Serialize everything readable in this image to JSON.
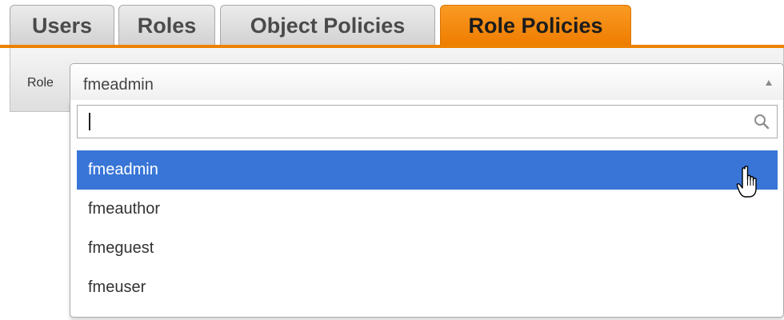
{
  "tabs": [
    {
      "label": "Users",
      "active": false
    },
    {
      "label": "Roles",
      "active": false
    },
    {
      "label": "Object Policies",
      "active": false
    },
    {
      "label": "Role Policies",
      "active": true
    }
  ],
  "role_field": {
    "label": "Role",
    "selected_value": "fmeadmin",
    "search_value": "",
    "options": [
      {
        "label": "fmeadmin",
        "highlighted": true
      },
      {
        "label": "fmeauthor",
        "highlighted": false
      },
      {
        "label": "fmeguest",
        "highlighted": false
      },
      {
        "label": "fmeuser",
        "highlighted": false
      }
    ]
  },
  "colors": {
    "active_tab": "#ee7d00",
    "highlight": "#3875d7"
  },
  "icons": {
    "search": "search-icon",
    "arrow": "chevron-up-icon",
    "cursor": "hand-pointer-icon"
  }
}
